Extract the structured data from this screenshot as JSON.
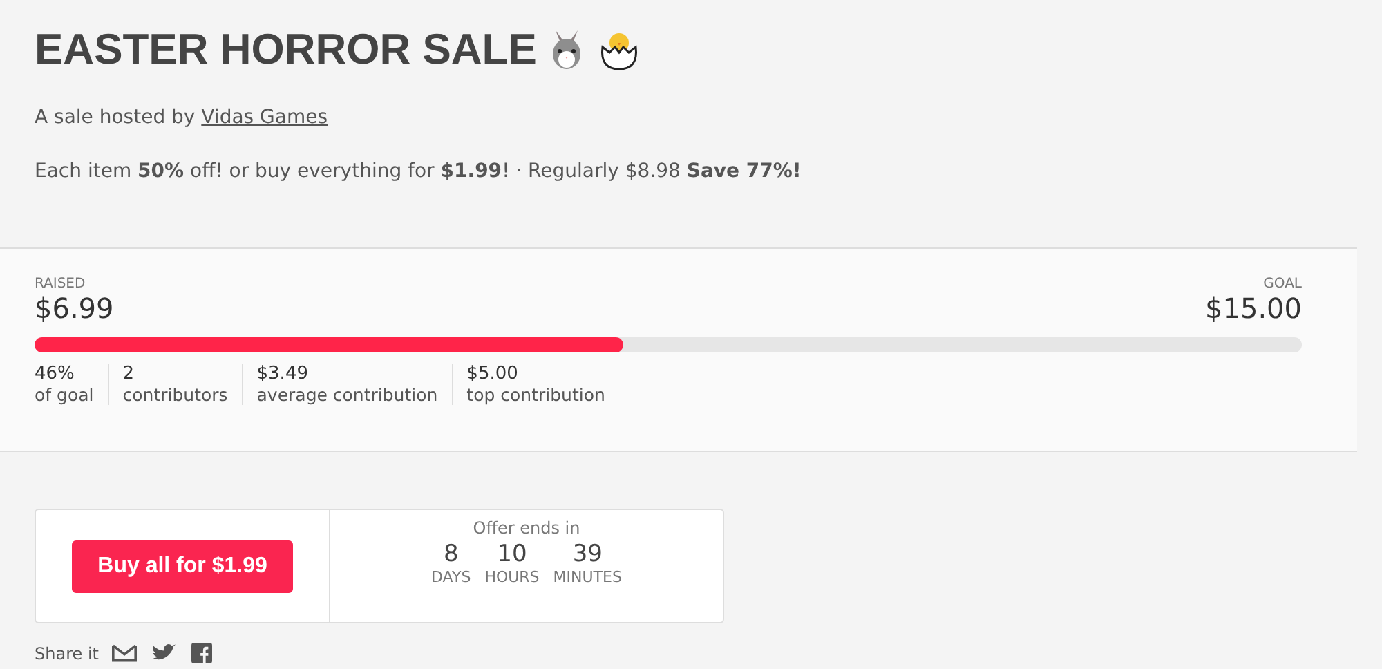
{
  "title": "EASTER HORROR SALE",
  "host": {
    "prefix": "A sale hosted by",
    "link": "Vidas Games"
  },
  "offer": "Each item **50%** off! or buy everything for **$1.99**! · Regularly $8.98 **Save 77%!**",
  "raised": {
    "label": "RAISED",
    "amount": "$6.99"
  },
  "goal": {
    "label": "GOAL",
    "amount": "$15.00"
  },
  "progress": {
    "level": 0.465
  },
  "stats": [
    {
      "value": "46%",
      "label": "of goal"
    },
    {
      "value": "2",
      "label": "contributors"
    },
    {
      "value": "$3.49",
      "label": "average contribution"
    },
    {
      "value": "$5.00",
      "label": "top contribution"
    }
  ],
  "buy_button": "Buy all for $1.99",
  "countdown": {
    "heading": "Offer ends in",
    "units": [
      {
        "value": "8",
        "label": "DAYS"
      },
      {
        "value": "10",
        "label": "HOURS"
      },
      {
        "value": "39",
        "label": "MINUTES"
      }
    ]
  },
  "share": {
    "label": "Share it"
  }
}
